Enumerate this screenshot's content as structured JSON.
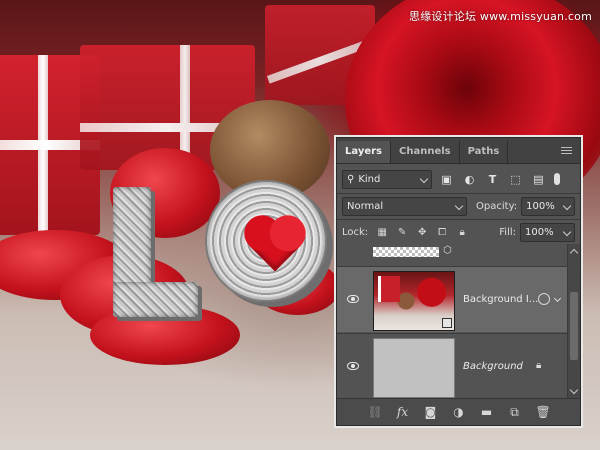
{
  "watermark": "思缘设计论坛 www.missyuan.com",
  "panel": {
    "tabs": [
      {
        "label": "Layers",
        "active": true
      },
      {
        "label": "Channels",
        "active": false
      },
      {
        "label": "Paths",
        "active": false
      }
    ],
    "filter": {
      "kind_label": "Kind"
    },
    "blend_mode": "Normal",
    "opacity_label": "Opacity:",
    "opacity_value": "100%",
    "lock_label": "Lock:",
    "fill_label": "Fill:",
    "fill_value": "100%",
    "layers": [
      {
        "name": "Background I...",
        "selected": true,
        "visible": true
      },
      {
        "name": "Background",
        "selected": false,
        "visible": true,
        "italic": true
      }
    ],
    "icons": {
      "filter_tools": [
        "image-filter-icon",
        "adjustment-filter-icon",
        "type-filter-icon",
        "shape-filter-icon",
        "smart-object-filter-icon",
        "filter-toggle-icon"
      ],
      "lock_tools": [
        "lock-transparent-icon",
        "lock-image-icon",
        "lock-position-icon",
        "lock-artboard-icon",
        "lock-all-icon"
      ],
      "bottom_tools": [
        "link-layers-icon",
        "fx-icon",
        "add-mask-icon",
        "adjustment-layer-icon",
        "new-group-icon",
        "new-layer-icon",
        "delete-layer-icon"
      ]
    }
  }
}
